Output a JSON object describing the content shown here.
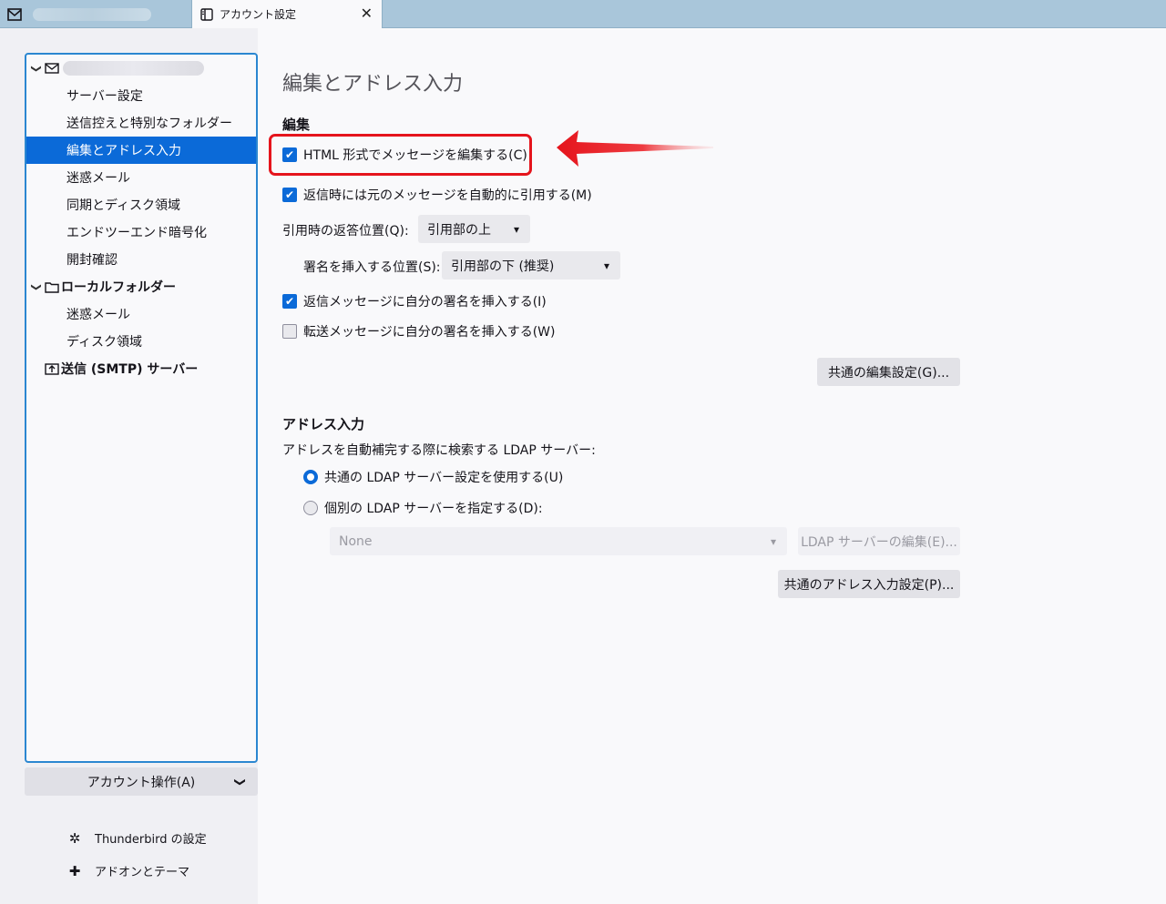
{
  "tabs": {
    "active_title": "アカウント設定",
    "close_glyph": "✕"
  },
  "sidebar": {
    "tree": {
      "account_children": [
        "サーバー設定",
        "送信控えと特別なフォルダー",
        "編集とアドレス入力",
        "迷惑メール",
        "同期とディスク領域",
        "エンドツーエンド暗号化",
        "開封確認"
      ],
      "selected_index": 2,
      "local_folders_label": "ローカルフォルダー",
      "local_children": [
        "迷惑メール",
        "ディスク領域"
      ],
      "smtp_label": "送信 (SMTP) サーバー"
    },
    "account_actions_label": "アカウント操作(A)",
    "settings_link": "Thunderbird の設定",
    "addons_link": "アドオンとテーマ"
  },
  "main": {
    "page_title": "編集とアドレス入力",
    "compose": {
      "heading": "編集",
      "html_compose": {
        "label": "HTML 形式でメッセージを編集する(C)",
        "checked": true
      },
      "auto_quote": {
        "label": "返信時には元のメッセージを自動的に引用する(M)",
        "checked": true
      },
      "reply_position_label": "引用時の返答位置(Q):",
      "reply_position_value": "引用部の上",
      "signature_position_label": "署名を挿入する位置(S):",
      "signature_position_value": "引用部の下 (推奨)",
      "sig_reply": {
        "label": "返信メッセージに自分の署名を挿入する(I)",
        "checked": true
      },
      "sig_forward": {
        "label": "転送メッセージに自分の署名を挿入する(W)",
        "checked": false
      },
      "global_compose_button": "共通の編集設定(G)..."
    },
    "addressing": {
      "heading": "アドレス入力",
      "description": "アドレスを自動補完する際に検索する LDAP サーバー:",
      "use_global": {
        "label": "共通の LDAP サーバー設定を使用する(U)",
        "selected": true
      },
      "use_specific": {
        "label": "個別の LDAP サーバーを指定する(D):",
        "selected": false
      },
      "ldap_select_value": "None",
      "edit_ldap_button": "LDAP サーバーの編集(E)...",
      "global_addressing_button": "共通のアドレス入力設定(P)..."
    }
  },
  "colors": {
    "accent": "#0b6ad8",
    "annotation_red": "#e5141c",
    "tabbar": "#a9c6da"
  },
  "icons": [
    "mail-icon",
    "account-settings-tab-icon",
    "folder-icon",
    "smtp-icon",
    "gear-icon",
    "puzzle-icon",
    "chevron-down-icon"
  ]
}
